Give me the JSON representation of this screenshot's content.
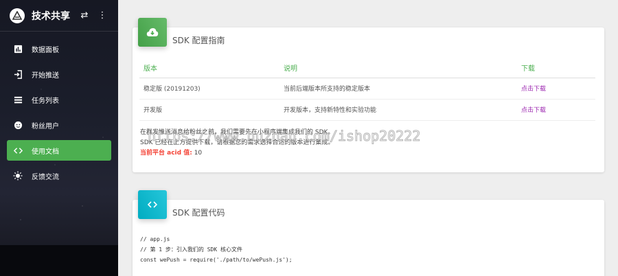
{
  "brand": {
    "title": "技术共享",
    "swap_icon": "⇄",
    "more_icon": "⋮"
  },
  "nav": [
    {
      "label": "数据面板",
      "icon": "bar-chart-icon"
    },
    {
      "label": "开始推送",
      "icon": "login-icon"
    },
    {
      "label": "任务列表",
      "icon": "list-icon"
    },
    {
      "label": "粉丝用户",
      "icon": "face-icon"
    },
    {
      "label": "使用文档",
      "icon": "code-icon",
      "active": true
    },
    {
      "label": "反馈交流",
      "icon": "sun-icon"
    }
  ],
  "guide": {
    "title": "SDK 配置指南",
    "headers": [
      "版本",
      "说明",
      "下载"
    ],
    "rows": [
      {
        "version": "稳定版 (20191203)",
        "desc": "当前后端版本所支持的稳定版本",
        "link": "点击下载"
      },
      {
        "version": "开发版",
        "desc": "开发版本，支持新特性和实验功能",
        "link": "点击下载"
      }
    ],
    "note1": "在群发推送消息给粉丝之前，我们需要先在小程序端集成我们的 SDK。",
    "note2": "SDK 已经在上方提供下载，请根据您的需求选择合适的版本进行集成。",
    "acid_label": "当前平台 acid 值:",
    "acid_value": "10"
  },
  "code": {
    "title": "SDK 配置代码",
    "lines": [
      "// app.js",
      "// 第 1 步：引入我们的 SDK 核心文件",
      "const wePush = require('./path/to/wePush.js');"
    ]
  },
  "watermark": "https://www.huzhan.com/ishop20222",
  "colors": {
    "accent": "#4caf50",
    "link": "#9c27b0",
    "red": "#f44336",
    "cyan": "#00bcd4"
  }
}
